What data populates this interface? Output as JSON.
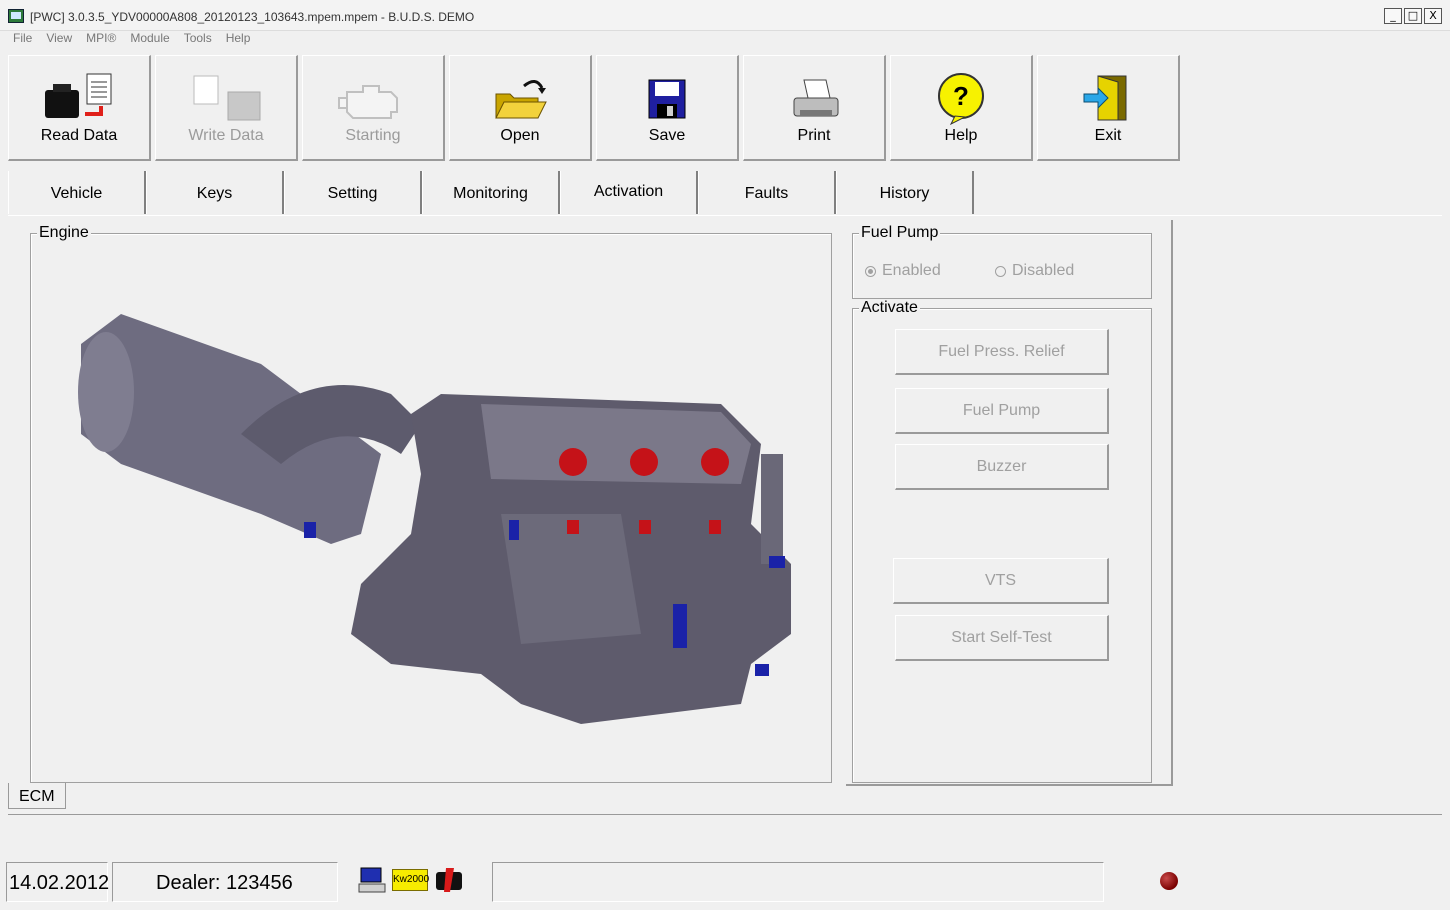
{
  "window": {
    "title": "[PWC] 3.0.3.5_YDV00000A808_20120123_103643.mpem.mpem - B.U.D.S. DEMO",
    "controls": [
      "_",
      "□",
      "X"
    ]
  },
  "menu": [
    "File",
    "View",
    "MPI®",
    "Module",
    "Tools",
    "Help"
  ],
  "toolbar": {
    "read_data": "Read Data",
    "write_data": "Write Data",
    "starting": "Starting",
    "open": "Open",
    "save": "Save",
    "print": "Print",
    "help": "Help",
    "exit": "Exit"
  },
  "tabs": [
    "Vehicle",
    "Keys",
    "Setting",
    "Monitoring",
    "Activation",
    "Faults",
    "History"
  ],
  "active_tab": "Activation",
  "engine_group": {
    "title": "Engine"
  },
  "fuel_pump": {
    "title": "Fuel Pump",
    "enabled_label": "Enabled",
    "disabled_label": "Disabled",
    "selected": "Enabled"
  },
  "activate": {
    "title": "Activate",
    "fuel_press_relief": "Fuel Press. Relief",
    "fuel_pump": "Fuel Pump",
    "buzzer": "Buzzer",
    "vts": "VTS",
    "start_self_test": "Start Self-Test"
  },
  "bottom_tab": "ECM",
  "status": {
    "date": "14.02.2012",
    "dealer": "Dealer: 123456",
    "protocol_badge": "Kw2000",
    "led_color": "#8b0000"
  }
}
